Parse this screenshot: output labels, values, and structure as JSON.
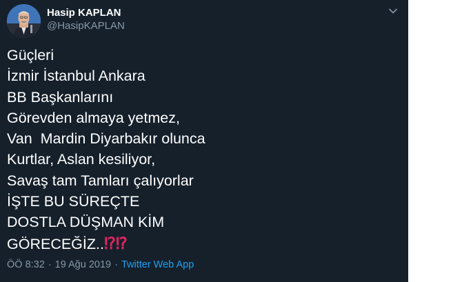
{
  "author": {
    "display_name": "Hasip KAPLAN",
    "handle": "@HasipKAPLAN"
  },
  "tweet": {
    "lines": [
      "Güçleri",
      "İzmir İstanbul Ankara",
      "BB Başkanlarını",
      "Görevden almaya yetmez,",
      "Van  Mardin Diyarbakır olunca",
      "Kurtlar, Aslan kesiliyor,",
      "Savaş tam Tamları çalıyorlar",
      "İŞTE BU SÜREÇTE",
      "DOSTLA DÜŞMAN KİM",
      "GÖRECEĞİZ.."
    ],
    "trailing_emoji": "⁉⁉"
  },
  "meta": {
    "time": "ÖÖ 8:32",
    "separator": "·",
    "date": "19 Ağu 2019",
    "source": "Twitter Web App"
  },
  "icons": {
    "avatar": "profile-photo",
    "menu": "chevron-down-icon"
  },
  "colors": {
    "background": "#15202b",
    "text": "#ffffff",
    "secondary": "#8899a6",
    "link": "#1da1f2",
    "emoji": "#e0245e"
  }
}
